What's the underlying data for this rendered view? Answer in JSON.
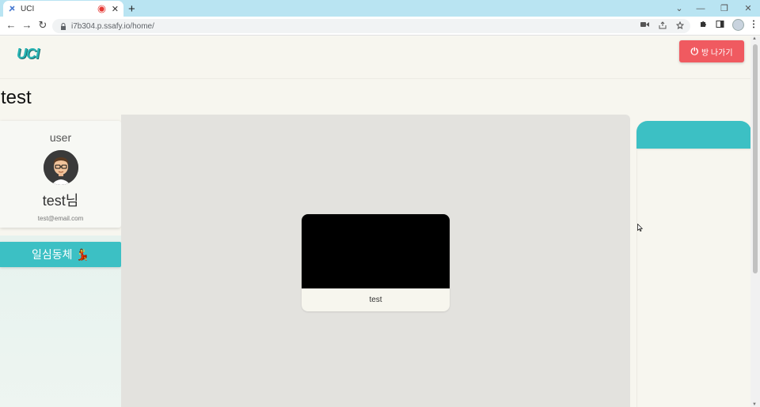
{
  "browser": {
    "tab_title": "UCI",
    "tab_close": "✕",
    "new_tab": "+",
    "window_controls": [
      "⌄",
      "—",
      "❐",
      "✕"
    ],
    "back": "←",
    "forward": "→",
    "reload": "↻",
    "url": "i7b304.p.ssafy.io/home/"
  },
  "header": {
    "logo_text": "UCI",
    "leave_button": {
      "icon": "⏻",
      "label": "방 나가기"
    }
  },
  "room": {
    "title": "test"
  },
  "user_card": {
    "role": "user",
    "name": "test님",
    "email": "test@email.com"
  },
  "sync_button": {
    "label": "일심동체",
    "emoji": "💃"
  },
  "video": {
    "participant_name": "test"
  },
  "colors": {
    "accent_teal": "#3cc0c4",
    "leave_red": "#f05a60",
    "stage_gray": "#e3e2de"
  }
}
